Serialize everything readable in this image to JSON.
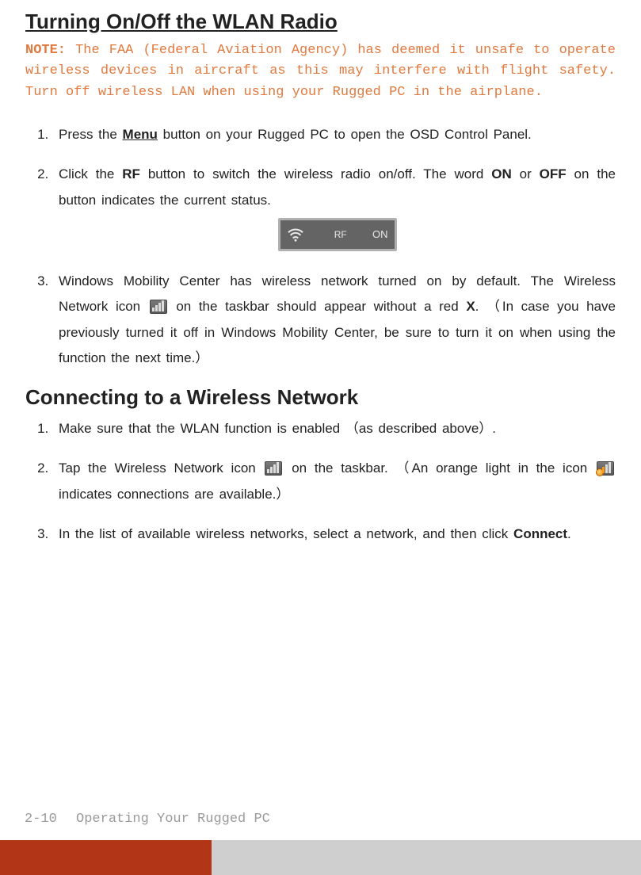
{
  "colors": {
    "note": "#e07a3f",
    "accent": "#d04626",
    "muted": "#9a9a9a"
  },
  "section1": {
    "heading": "Turning On/Off the WLAN Radio"
  },
  "note": {
    "label": "NOTE:",
    "text": " The FAA (Federal Aviation Agency) has deemed it unsafe to operate wireless devices in aircraft as this may interfere with flight safety. Turn off wireless LAN when using your Rugged PC in the airplane."
  },
  "steps1": {
    "s1": {
      "pre": "Press the ",
      "menu": "Menu",
      "post": " button on your Rugged PC to open the OSD Control Panel."
    },
    "s2": {
      "a": "Click the ",
      "rf": "RF",
      "b": " button to switch the wireless radio on/off. The word ",
      "on": "ON",
      "c": " or ",
      "off": "OFF",
      "d": " on the button indicates the current status."
    },
    "s3": {
      "a": "Windows Mobility Center has wireless network turned on by default. The Wireless Network icon ",
      "b": " on the taskbar should appear without a red ",
      "x": "X",
      "c": ". （In case you have previously turned it off in Windows Mobility Center, be sure to turn it on when using the function the next time.）"
    }
  },
  "widget": {
    "label": "RF",
    "status": "ON"
  },
  "section2": {
    "heading": "Connecting to a Wireless Network"
  },
  "steps2": {
    "s1": "Make sure that the WLAN function is enabled （as described above）.",
    "s2": {
      "a": "Tap the Wireless Network icon ",
      "b": " on the taskbar. （An orange light in the icon ",
      "c": " indicates connections are available.）"
    },
    "s3": {
      "a": "In the list of available wireless networks, select a network, and then click ",
      "connect": "Connect",
      "b": "."
    }
  },
  "footer": {
    "page": "2-10",
    "title": "Operating Your Rugged PC"
  }
}
